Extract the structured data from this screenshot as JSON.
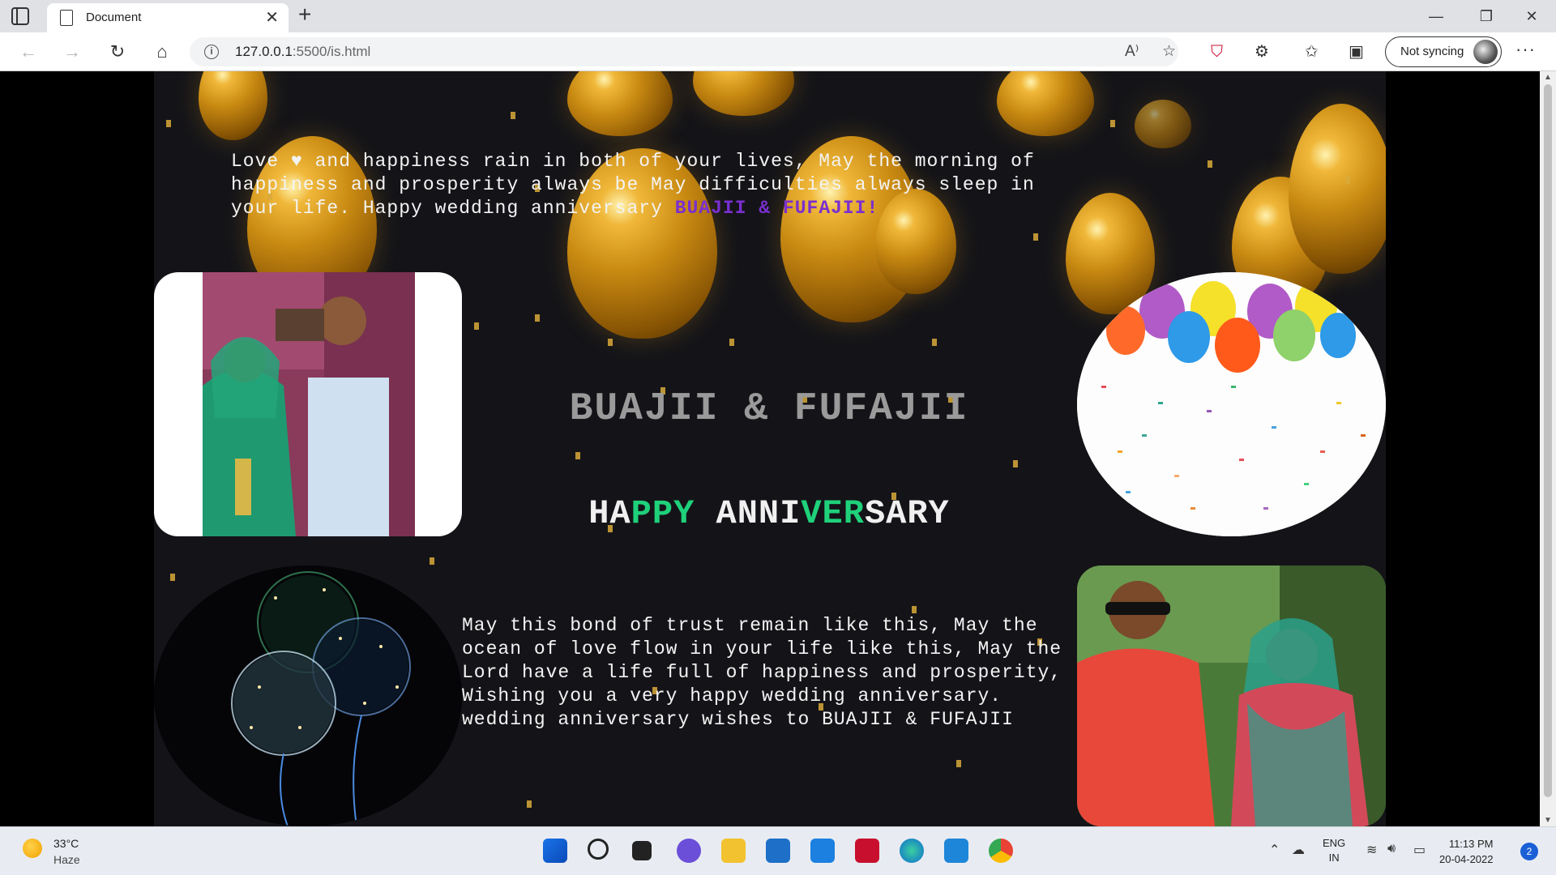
{
  "browser": {
    "tab_title": "Document",
    "url_host": "127.0.0.1",
    "url_rest": ":5500/is.html",
    "sync_label": "Not syncing"
  },
  "page": {
    "intro_text": "Love ♥ and happiness  rain in both of your lives, May the morning of happiness and prosperity always be May difficulties always sleep in your life. Happy wedding anniversary ",
    "intro_names": "BUAJII & FUFAJII!",
    "heading_names": "BUAJII & FUFAJII",
    "heading_anniv_parts": [
      "HA",
      "PPY",
      " ANNI",
      "VER",
      "SARY"
    ],
    "wish_text": "May this bond of trust remain like this, May the ocean of love flow in your life like this, May the Lord have a life full of happiness and prosperity, Wishing you a very happy wedding anniversary. wedding anniversary wishes to BUAJII & FUFAJII"
  },
  "taskbar": {
    "temperature": "33°C",
    "weather": "Haze",
    "lang_top": "ENG",
    "lang_bottom": "IN",
    "time": "11:13 PM",
    "date": "20-04-2022",
    "notifications": "2"
  },
  "colors": {
    "names_accent": "#7a2fd0",
    "anniv_green": "#1fd17a",
    "page_bg": "#141418"
  }
}
